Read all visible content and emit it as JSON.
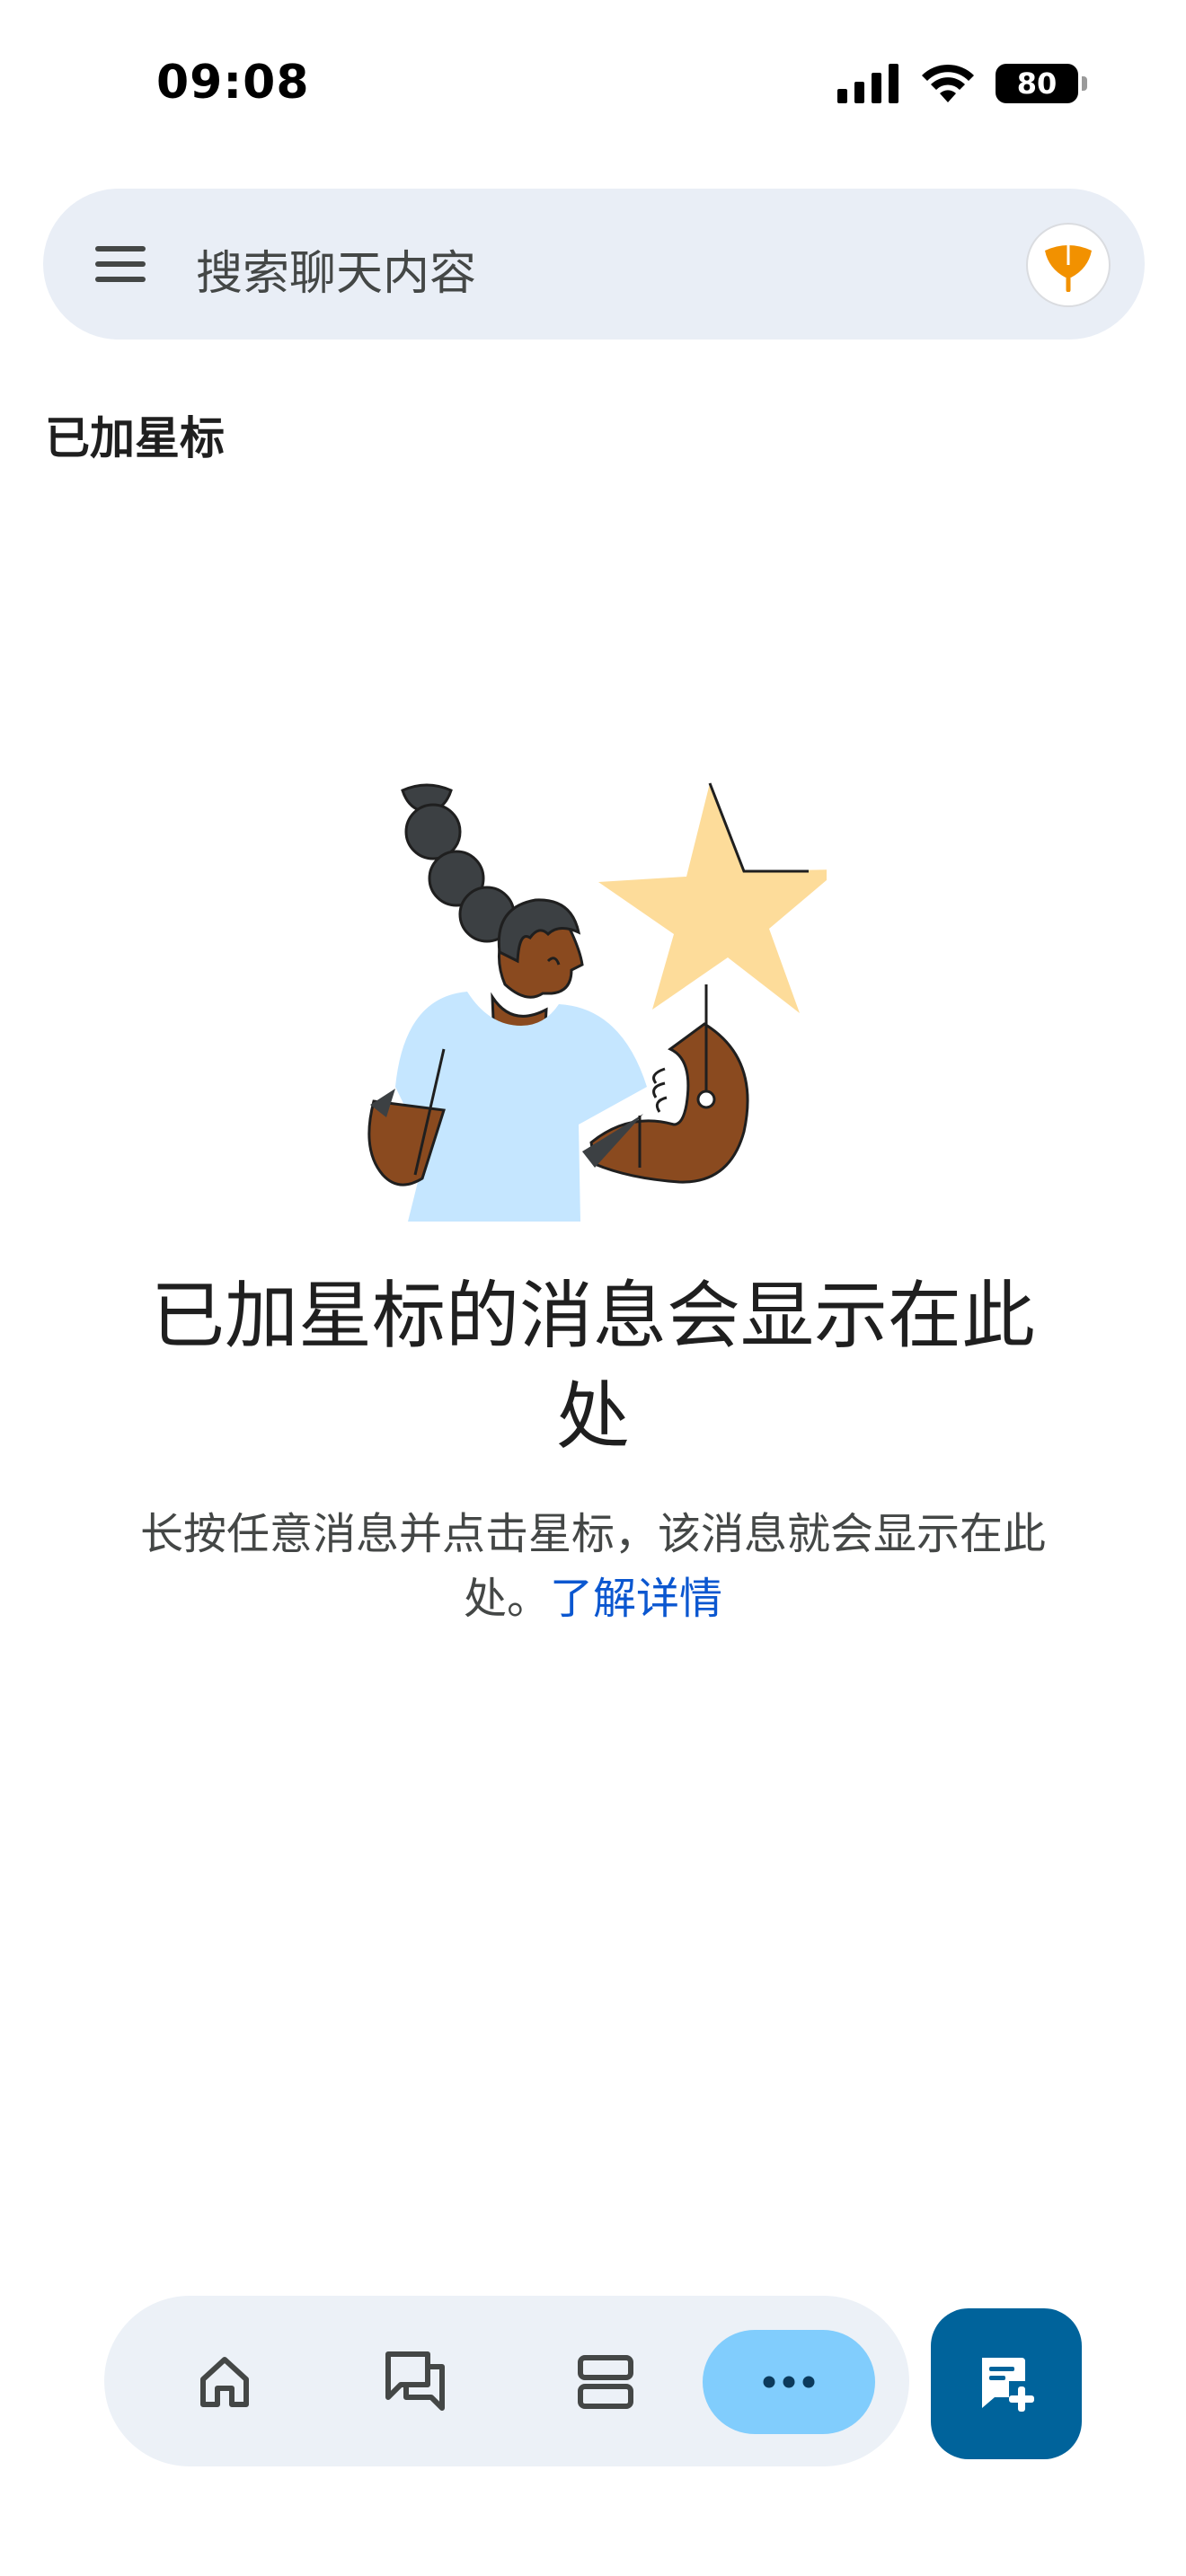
{
  "status_bar": {
    "time": "09:08",
    "battery": "80"
  },
  "search": {
    "placeholder": "搜索聊天内容"
  },
  "section": {
    "title": "已加星标"
  },
  "empty_state": {
    "headline": "已加星标的消息会显示在此处",
    "description": "长按任意消息并点击星标，该消息就会显示在此处。",
    "link": "了解详情"
  },
  "colors": {
    "search_bg": "#e9eef6",
    "nav_bg": "#ecf1f7",
    "active_pill": "#81cdfd",
    "fab": "#00639b",
    "link": "#0b57d0",
    "star": "#fddc9a",
    "shirt": "#c5e6ff",
    "skin": "#8a4a1f"
  },
  "icons": {
    "menu": "hamburger-icon",
    "avatar": "ginkgo-leaf-icon",
    "nav": [
      "home-icon",
      "chat-icon",
      "spaces-icon",
      "more-icon"
    ],
    "fab": "new-chat-icon"
  }
}
